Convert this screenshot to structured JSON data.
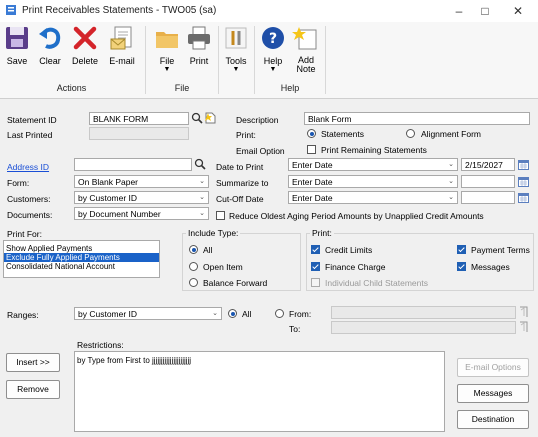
{
  "window": {
    "title": "Print Receivables Statements  -  TWO05 (sa)",
    "controls": [
      "minimize",
      "maximize",
      "close"
    ]
  },
  "toolbar": {
    "save": "Save",
    "clear": "Clear",
    "delete": "Delete",
    "email": "E-mail",
    "file": "File",
    "print": "Print",
    "tools": "Tools",
    "help": "Help",
    "add_note_1": "Add",
    "add_note_2": "Note",
    "group_actions": "Actions",
    "group_file": "File",
    "group_help": "Help"
  },
  "form": {
    "statement_id_label": "Statement ID",
    "statement_id": "BLANK FORM",
    "last_printed_label": "Last Printed",
    "last_printed": "",
    "description_label": "Description",
    "description": "Blank Form",
    "print_label": "Print:",
    "print_statements": "Statements",
    "print_alignment": "Alignment Form",
    "email_option_label": "Email Option",
    "print_remaining": "Print Remaining Statements",
    "address_id_label": "Address ID",
    "address_id": "",
    "form_label": "Form:",
    "form_value": "On Blank Paper",
    "customers_label": "Customers:",
    "customers_value": "by Customer ID",
    "documents_label": "Documents:",
    "documents_value": "by Document Number",
    "date_to_print_label": "Date to Print",
    "date_to_print_value": "Enter Date",
    "date_to_print_date": "2/15/2027",
    "summarize_to_label": "Summarize to",
    "summarize_to_value": "Enter Date",
    "cutoff_date_label": "Cut-Off Date",
    "cutoff_date_value": "Enter Date",
    "reduce_aging": "Reduce Oldest Aging Period Amounts by Unapplied Credit Amounts"
  },
  "print_for": {
    "label": "Print For:",
    "items": [
      "Show Applied Payments",
      "Exclude Fully Applied Payments",
      "Consolidated National Account"
    ],
    "selected_index": 1
  },
  "include_type": {
    "label": "Include Type:",
    "all": "All",
    "open_item": "Open Item",
    "balance_forward": "Balance Forward"
  },
  "print_options": {
    "label": "Print:",
    "credit_limits": "Credit Limits",
    "payment_terms": "Payment Terms",
    "finance_charge": "Finance Charge",
    "messages": "Messages",
    "individual_child": "Individual Child Statements"
  },
  "ranges": {
    "label": "Ranges:",
    "value": "by Customer ID",
    "all": "All",
    "from": "From:",
    "to": "To:"
  },
  "restrictions": {
    "label": "Restrictions:",
    "items": [
      "by Type from First to jjjjjjjjjjjjjjjjjjjjjj"
    ]
  },
  "buttons": {
    "insert": "Insert >>",
    "remove": "Remove",
    "email_options": "E-mail Options",
    "messages": "Messages",
    "destination": "Destination"
  }
}
